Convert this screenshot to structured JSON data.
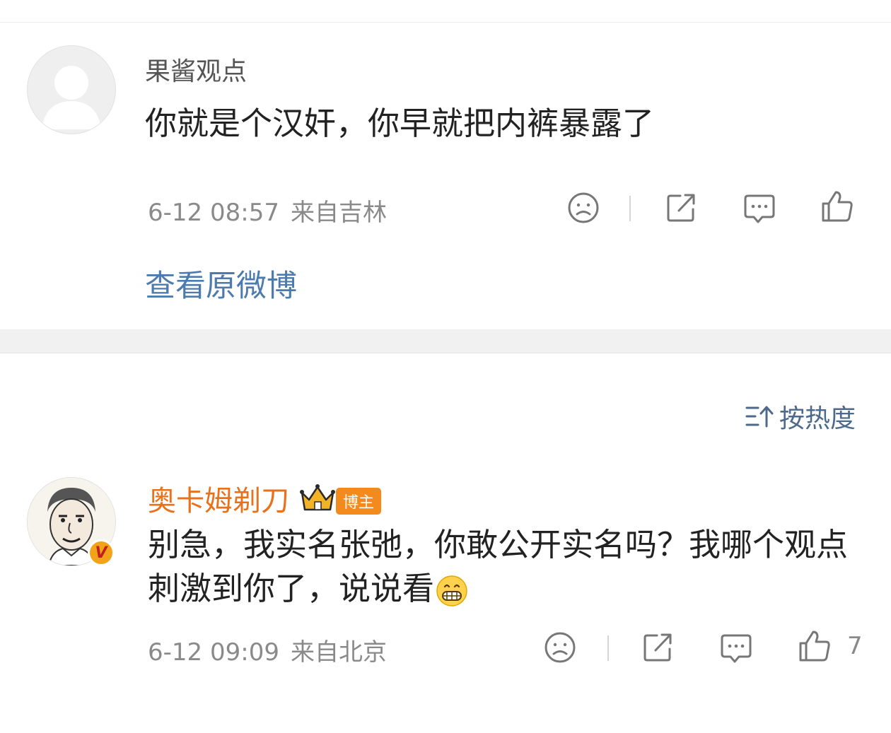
{
  "comment1": {
    "author": "果酱观点",
    "text": "你就是个汉奸，你早就把内裤暴露了",
    "time": "6-12 08:57",
    "location": "来自吉林"
  },
  "view_original_label": "查看原微博",
  "sort_label": "按热度",
  "comment2": {
    "author": "奥卡姆剃刀",
    "badge_label": "博主",
    "verified_mark": "V",
    "text": "别急，我实名张弛，你敢公开实名吗？我哪个观点刺激到你了，说说看",
    "time": "6-12 09:09",
    "location": "来自北京",
    "like_count": "7"
  },
  "icons": [
    "sad-face-icon",
    "share-icon",
    "comment-icon",
    "thumbs-up-icon",
    "sort-icon",
    "crown-icon",
    "grin-emoji-icon"
  ],
  "colors": {
    "author_orange": "#e8721c",
    "link_blue": "#4d7bad",
    "badge_orange": "#f28a1e",
    "meta_gray": "#8a8a8a"
  }
}
